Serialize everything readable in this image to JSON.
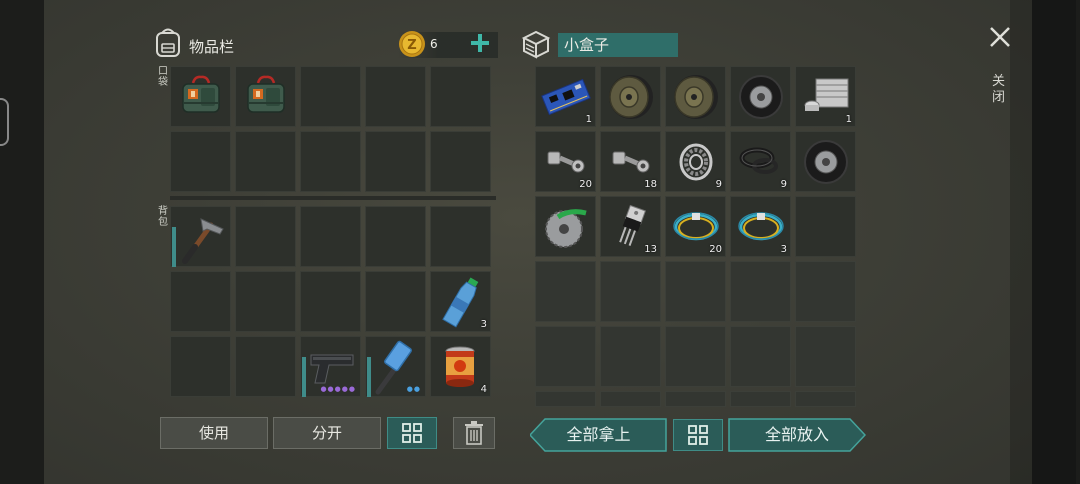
{
  "inventory": {
    "title": "物品栏",
    "currency_amount": "6",
    "pocket_label": "口袋",
    "backpack_label": "背包",
    "pocket_slots": [
      {
        "icon": "medkit-bag-icon",
        "qty": ""
      },
      {
        "icon": "medkit-bag-icon",
        "qty": ""
      },
      {
        "icon": "",
        "qty": ""
      },
      {
        "icon": "",
        "qty": ""
      },
      {
        "icon": "",
        "qty": ""
      },
      {
        "icon": "",
        "qty": ""
      },
      {
        "icon": "",
        "qty": ""
      },
      {
        "icon": "",
        "qty": ""
      },
      {
        "icon": "",
        "qty": ""
      },
      {
        "icon": "",
        "qty": ""
      }
    ],
    "backpack_slots": [
      {
        "icon": "hammer-icon",
        "qty": ""
      },
      {
        "icon": "",
        "qty": ""
      },
      {
        "icon": "",
        "qty": ""
      },
      {
        "icon": "",
        "qty": ""
      },
      {
        "icon": "",
        "qty": ""
      },
      {
        "icon": "",
        "qty": ""
      },
      {
        "icon": "",
        "qty": ""
      },
      {
        "icon": "",
        "qty": ""
      },
      {
        "icon": "",
        "qty": ""
      },
      {
        "icon": "water-bottle-icon",
        "qty": "3"
      },
      {
        "icon": "",
        "qty": ""
      },
      {
        "icon": "",
        "qty": ""
      },
      {
        "icon": "pistol-icon",
        "qty": ""
      },
      {
        "icon": "sledgehammer-icon",
        "qty": ""
      },
      {
        "icon": "canned-food-icon",
        "qty": "4"
      }
    ]
  },
  "container": {
    "title": "小盒子",
    "slots": [
      {
        "icon": "circuit-board-icon",
        "qty": "1"
      },
      {
        "icon": "brake-disc-icon",
        "qty": ""
      },
      {
        "icon": "brake-disc-icon",
        "qty": ""
      },
      {
        "icon": "tire-icon",
        "qty": ""
      },
      {
        "icon": "engine-block-icon",
        "qty": "1"
      },
      {
        "icon": "bolt-nut-icon",
        "qty": "20"
      },
      {
        "icon": "bolt-nut-icon",
        "qty": "18"
      },
      {
        "icon": "bearing-icon",
        "qty": "9"
      },
      {
        "icon": "rubber-seal-icon",
        "qty": "9"
      },
      {
        "icon": "tire-icon",
        "qty": ""
      },
      {
        "icon": "saw-blade-icon",
        "qty": ""
      },
      {
        "icon": "transistor-icon",
        "qty": "13"
      },
      {
        "icon": "wire-bundle-icon",
        "qty": "20"
      },
      {
        "icon": "wire-bundle-icon",
        "qty": "3"
      },
      {
        "icon": "",
        "qty": ""
      }
    ]
  },
  "buttons": {
    "use": "使用",
    "split": "分开",
    "take_all": "全部拿上",
    "put_all": "全部放入",
    "close": "关闭"
  },
  "colors": {
    "teal_accent": "#2f6e69",
    "currency_gold": "#d9a520",
    "plus_teal": "#3fb7a8"
  }
}
